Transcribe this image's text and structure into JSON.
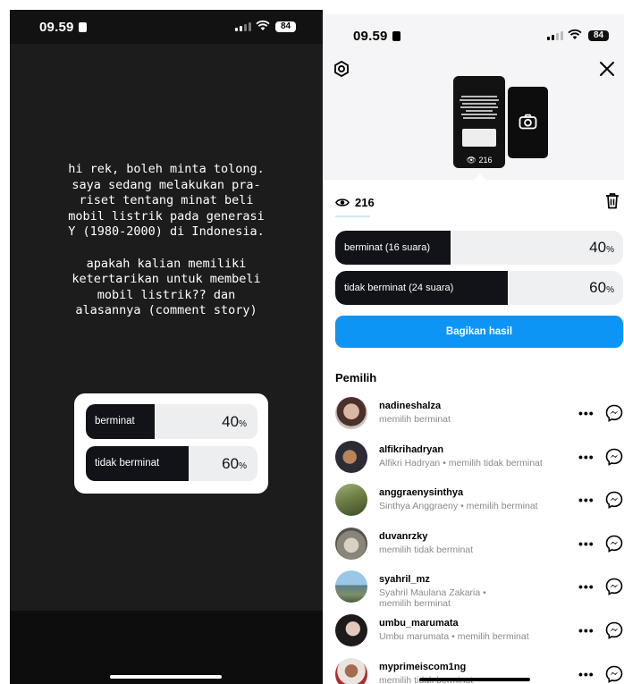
{
  "status": {
    "time": "09.59",
    "battery": "84"
  },
  "story": {
    "text": "hi rek, boleh minta tolong.\nsaya sedang melakukan pra-\nriset tentang minat beli\nmobil listrik pada generasi\nY (1980-2000) di Indonesia.\n\napakah kalian memiliki\nketertarikan untuk membeli\nmobil listrik?? dan\nalasannya (comment story)",
    "poll": {
      "options": [
        {
          "label": "berminat",
          "percent": 40,
          "pct_text": "40",
          "pct_sign": "%"
        },
        {
          "label": "tidak berminat",
          "percent": 60,
          "pct_text": "60",
          "pct_sign": "%"
        }
      ]
    }
  },
  "viewer_panel": {
    "thumb_views": "216",
    "views": "216",
    "results": [
      {
        "label": "berminat (16 suara)",
        "percent": 40,
        "pct_text": "40",
        "pct_sign": "%"
      },
      {
        "label": "tidak berminat (24 suara)",
        "percent": 60,
        "pct_text": "60",
        "pct_sign": "%"
      }
    ],
    "share_label": "Bagikan hasil",
    "voters_heading": "Pemilih",
    "voters": [
      {
        "username": "nadineshalza",
        "detail": "memilih berminat"
      },
      {
        "username": "alfikrihadryan",
        "detail": "Alfikri Hadryan • memilih tidak berminat"
      },
      {
        "username": "anggraenysinthya",
        "detail": "Sinthya Anggraeny • memilih berminat"
      },
      {
        "username": "duvanrzky",
        "detail": "memilih tidak berminat"
      },
      {
        "username": "syahril_mz",
        "detail": "Syahril Maulana Zakaria •\nmemilih berminat"
      },
      {
        "username": "umbu_marumata",
        "detail": "Umbu marumata • memilih berminat"
      },
      {
        "username": "myprimeiscom1ng",
        "detail": "memilih tidak berminat"
      }
    ],
    "more_label": "•••"
  },
  "colors": {
    "accent": "#0d95f6",
    "poll_fill": "#111318",
    "story_bg": "#1c1c1c"
  }
}
